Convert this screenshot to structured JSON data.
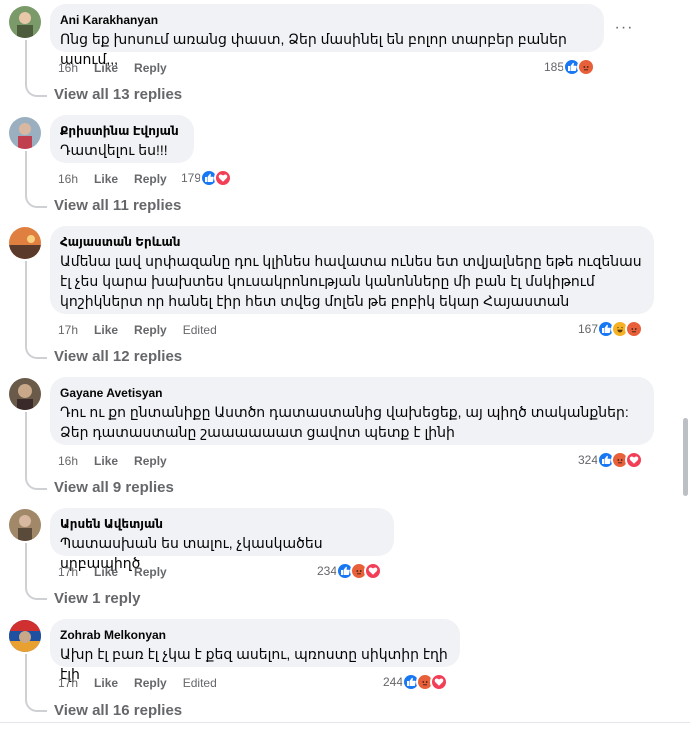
{
  "comments": [
    {
      "author": "Ani Karakhanyan",
      "text": "Ոնց եք խոսում առանց փաստ, Ձեր մասինել են բոլոր տարբեր բաներ ասում,,,",
      "time": "16h",
      "like": "Like",
      "reply": "Reply",
      "reaction_count": "185",
      "reactions": [
        "like",
        "angry"
      ],
      "view_replies": "View all 13 replies",
      "more": "···"
    },
    {
      "author": "Քրիստինա Էվոյան",
      "text": "Դատվելու ես!!!",
      "time": "16h",
      "like": "Like",
      "reply": "Reply",
      "reaction_count": "179",
      "reactions": [
        "like",
        "love"
      ],
      "view_replies": "View all 11 replies"
    },
    {
      "author": "Հայաստան Երևան",
      "text": "Ամենա լավ սրփազանը դու կլինես հավատա ունես ետ տվյալները եթե ուզենաս էլ չես կարա խախտես կուսակրոնության կանոնները մի բան էլ մսկիթում կոշիկներտ որ հանել էիր հետ տվեց մոլեն թե բոբիկ եկար Հայաստան",
      "time": "17h",
      "like": "Like",
      "reply": "Reply",
      "edited": "Edited",
      "reaction_count": "167",
      "reactions": [
        "like",
        "haha",
        "angry"
      ],
      "view_replies": "View all 12 replies"
    },
    {
      "author": "Gayane Avetisyan",
      "text": "Դու ու քո ընտանիքը Աստծո դատաստանից վախեցեք, այ պիղծ տականքներ: Ձեր դատաստանը շաաաաաատ ցավոտ պետք է լինի",
      "time": "16h",
      "like": "Like",
      "reply": "Reply",
      "reaction_count": "324",
      "reactions": [
        "like",
        "angry",
        "love"
      ],
      "view_replies": "View all 9 replies"
    },
    {
      "author": "Արսեն Ավետյան",
      "text": "Պատասխան ես տալու, չկասկածես սրբապիղծ",
      "time": "17h",
      "like": "Like",
      "reply": "Reply",
      "reaction_count": "234",
      "reactions": [
        "like",
        "angry",
        "love"
      ],
      "view_replies": "View 1 reply"
    },
    {
      "author": "Zohrab Melkonyan",
      "text": "Ախր էլ բառ էլ չկա է քեզ ասելու, պռոստը սիկտիր էղի էլի",
      "time": "17h",
      "like": "Like",
      "reply": "Reply",
      "edited": "Edited",
      "reaction_count": "244",
      "reactions": [
        "like",
        "angry",
        "love"
      ],
      "view_replies": "View all 16 replies"
    }
  ],
  "colors": {
    "like": "#1877f2",
    "angry": "#e8603a",
    "haha": "#f7b125",
    "love": "#f33e58",
    "bubble": "#f0f2f5",
    "meta_text": "#65676b"
  }
}
